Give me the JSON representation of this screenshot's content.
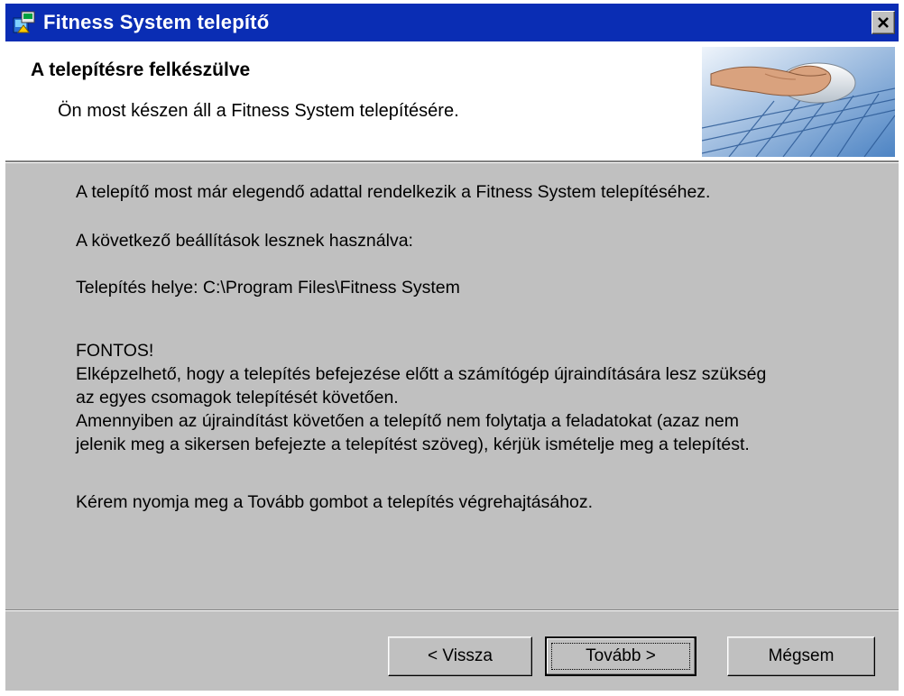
{
  "window": {
    "title": "Fitness System telepítő",
    "icon": "installer-icon",
    "close_icon": "close-icon"
  },
  "header": {
    "title": "A telepítésre felkészülve",
    "subtitle": "Ön most készen áll a Fitness System telepítésére.",
    "image": "hand-on-mouse-keyboard-graphic"
  },
  "body": {
    "line1": "A telepítő most már elegendő adattal rendelkezik a Fitness System telepítéséhez.",
    "line2": "A következő beállítások lesznek használva:",
    "line3": "Telepítés helye: C:\\Program Files\\Fitness System",
    "important_heading": "FONTOS!",
    "important_line1": "Elképzelhető, hogy a telepítés befejezése előtt a számítógép újraindítására lesz szükség",
    "important_line2": "az egyes csomagok telepítését követően.",
    "important_line3": "Amennyiben az újraindítást követően a telepítő nem folytatja a feladatokat (azaz nem",
    "important_line4": "jelenik meg a sikersen befejezte a telepítést szöveg), kérjük ismételje meg a telepítést.",
    "final_line": "Kérem nyomja meg a Tovább gombot a telepítés végrehajtásához."
  },
  "buttons": {
    "back": "< Vissza",
    "next": "Tovább >",
    "cancel": "Mégsem"
  },
  "colors": {
    "titlebar": "#0a2db4",
    "dialog_face": "#c0c0c0",
    "header_bg": "#ffffff"
  }
}
